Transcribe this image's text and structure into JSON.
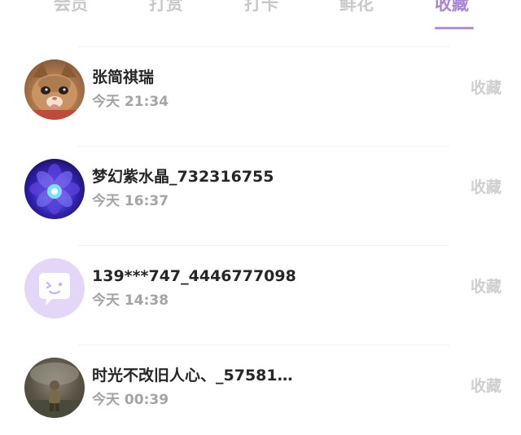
{
  "tabs": [
    {
      "label": "会员",
      "active": false
    },
    {
      "label": "打赏",
      "active": false
    },
    {
      "label": "打卡",
      "active": false
    },
    {
      "label": "鲜花",
      "active": false
    },
    {
      "label": "收藏",
      "active": true
    }
  ],
  "colors": {
    "accent": "#a883d6",
    "tab_inactive": "#c8c8c8",
    "name_text": "#262626",
    "time_text": "#a4a4a4",
    "action_text": "#cfcfcf"
  },
  "records": [
    {
      "name": "张简祺瑞",
      "time": "今天 21:34",
      "action": "收藏",
      "avatar_icon": "cat-photo"
    },
    {
      "name": "梦幻紫水晶_732316755",
      "time": "今天 16:37",
      "action": "收藏",
      "avatar_icon": "purple-crystal-flower"
    },
    {
      "name": "139***747_4446777098",
      "time": "今天 14:38",
      "action": "收藏",
      "avatar_icon": "default-chat-bubble-avatar"
    },
    {
      "name": "时光不改旧人心、_57581…",
      "time": "今天 00:39",
      "action": "收藏",
      "avatar_icon": "figure-photo"
    }
  ]
}
